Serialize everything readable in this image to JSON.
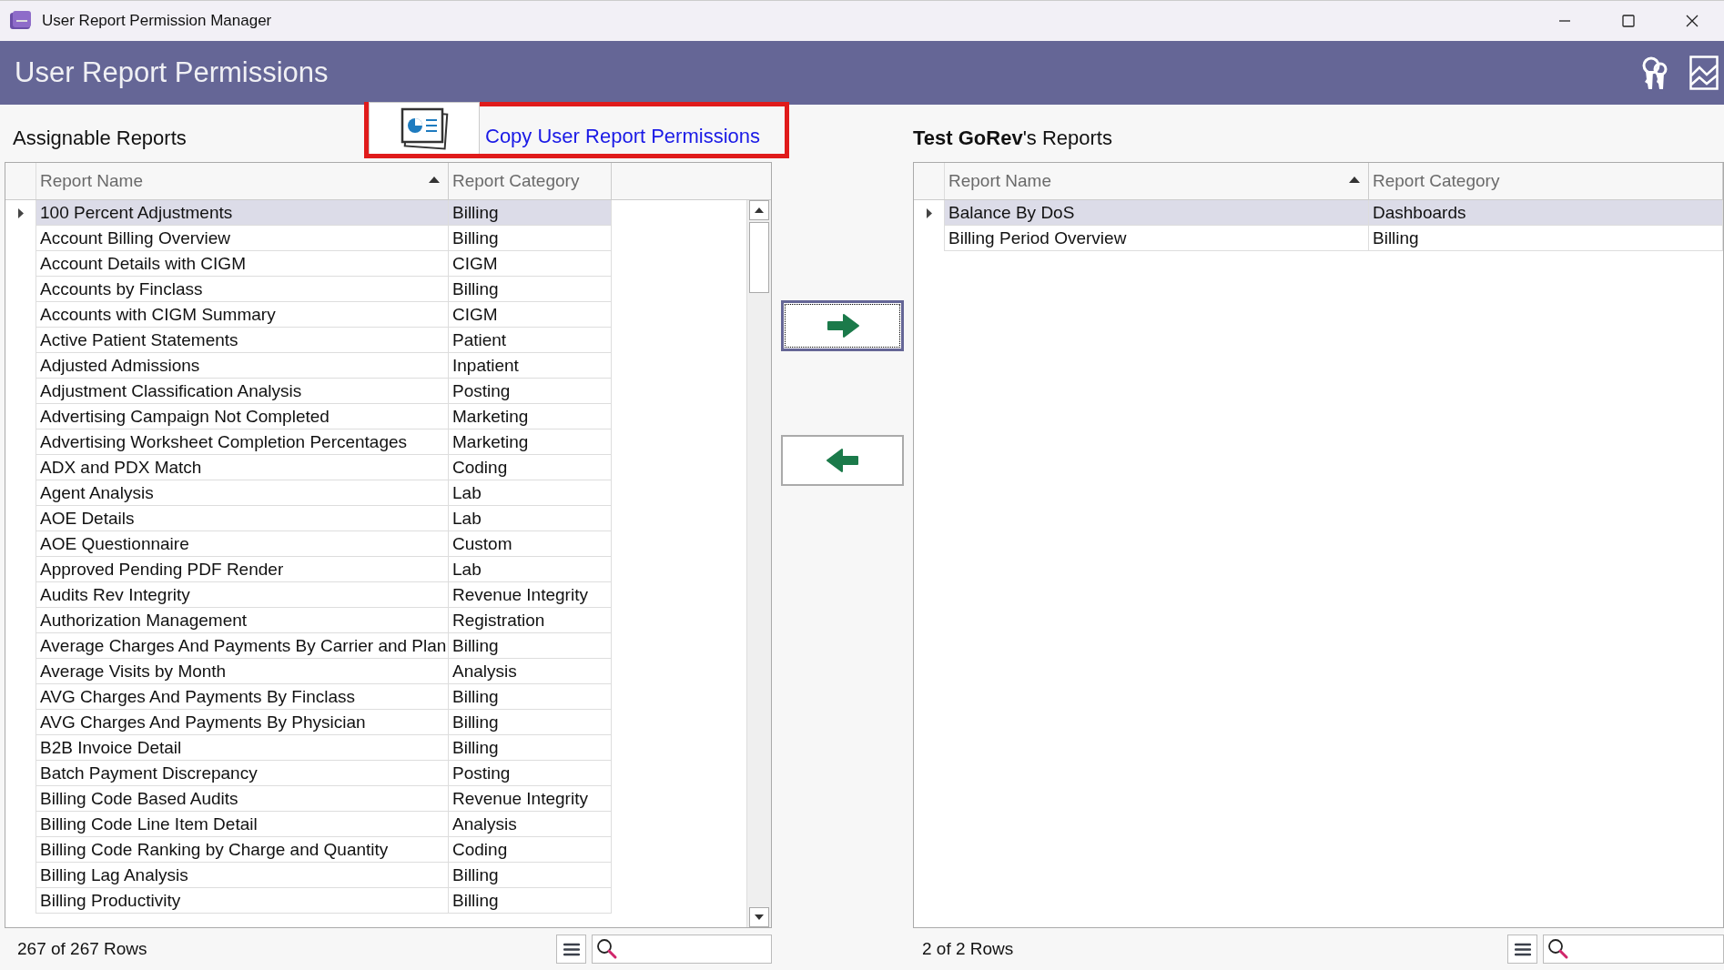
{
  "window": {
    "title": "User Report Permission Manager"
  },
  "header": {
    "title": "User Report Permissions"
  },
  "copy_button": {
    "label": "Copy User Report Permissions"
  },
  "assignable": {
    "title": "Assignable Reports",
    "columns": [
      {
        "label": "Report Name",
        "sorted": true
      },
      {
        "label": "Report Category",
        "sorted": false
      }
    ],
    "rows": [
      {
        "name": "100 Percent Adjustments",
        "category": "Billing",
        "selected": true
      },
      {
        "name": "Account Billing Overview",
        "category": "Billing",
        "selected": false
      },
      {
        "name": "Account Details with CIGM",
        "category": "CIGM",
        "selected": false
      },
      {
        "name": "Accounts by Finclass",
        "category": "Billing",
        "selected": false
      },
      {
        "name": "Accounts with CIGM Summary",
        "category": "CIGM",
        "selected": false
      },
      {
        "name": "Active Patient Statements",
        "category": "Patient",
        "selected": false
      },
      {
        "name": "Adjusted Admissions",
        "category": "Inpatient",
        "selected": false
      },
      {
        "name": "Adjustment Classification Analysis",
        "category": "Posting",
        "selected": false
      },
      {
        "name": "Advertising Campaign Not Completed",
        "category": "Marketing",
        "selected": false
      },
      {
        "name": "Advertising Worksheet Completion Percentages",
        "category": "Marketing",
        "selected": false
      },
      {
        "name": "ADX and PDX Match",
        "category": "Coding",
        "selected": false
      },
      {
        "name": "Agent Analysis",
        "category": "Lab",
        "selected": false
      },
      {
        "name": "AOE Details",
        "category": "Lab",
        "selected": false
      },
      {
        "name": "AOE Questionnaire",
        "category": "Custom",
        "selected": false
      },
      {
        "name": "Approved Pending PDF Render",
        "category": "Lab",
        "selected": false
      },
      {
        "name": "Audits Rev Integrity",
        "category": "Revenue Integrity",
        "selected": false
      },
      {
        "name": "Authorization Management",
        "category": "Registration",
        "selected": false
      },
      {
        "name": "Average Charges And Payments By Carrier and Plan",
        "category": "Billing",
        "selected": false
      },
      {
        "name": "Average Visits by Month",
        "category": "Analysis",
        "selected": false
      },
      {
        "name": "AVG Charges And Payments By Finclass",
        "category": "Billing",
        "selected": false
      },
      {
        "name": "AVG Charges And Payments By Physician",
        "category": "Billing",
        "selected": false
      },
      {
        "name": "B2B Invoice Detail",
        "category": "Billing",
        "selected": false
      },
      {
        "name": "Batch Payment Discrepancy",
        "category": "Posting",
        "selected": false
      },
      {
        "name": "Billing Code Based Audits",
        "category": "Revenue Integrity",
        "selected": false
      },
      {
        "name": "Billing Code Line Item Detail",
        "category": "Analysis",
        "selected": false
      },
      {
        "name": "Billing Code Ranking by Charge and Quantity",
        "category": "Coding",
        "selected": false
      },
      {
        "name": "Billing Lag Analysis",
        "category": "Billing",
        "selected": false
      },
      {
        "name": "Billing Productivity",
        "category": "Billing",
        "selected": false
      }
    ],
    "row_count": "267 of 267 Rows"
  },
  "assigned": {
    "title": "**Test GoRev**'s Reports",
    "columns": [
      {
        "label": "Report Name",
        "sorted": true
      },
      {
        "label": "Report Category",
        "sorted": false
      }
    ],
    "rows": [
      {
        "name": "Balance By DoS",
        "category": "Dashboards",
        "selected": true
      },
      {
        "name": "Billing Period Overview",
        "category": "Billing",
        "selected": false
      }
    ],
    "row_count": "2 of 2 Rows"
  }
}
